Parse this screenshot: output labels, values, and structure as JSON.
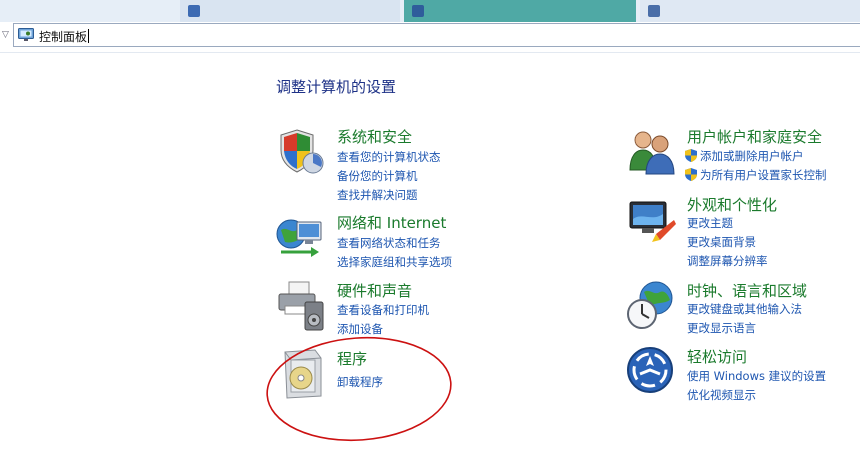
{
  "address_bar": {
    "path": "控制面板"
  },
  "main": {
    "title": "调整计算机的设置",
    "left": [
      {
        "title": "系统和安全",
        "links": [
          "查看您的计算机状态",
          "备份您的计算机",
          "查找并解决问题"
        ],
        "icon": "shield-icon"
      },
      {
        "title": "网络和 Internet",
        "links": [
          "查看网络状态和任务",
          "选择家庭组和共享选项"
        ],
        "icon": "network-globe-icon"
      },
      {
        "title": "硬件和声音",
        "links": [
          "查看设备和打印机",
          "添加设备"
        ],
        "icon": "printer-icon"
      },
      {
        "title": "程序",
        "links": [
          "卸载程序"
        ],
        "icon": "programs-disc-icon"
      }
    ],
    "right": [
      {
        "title": "用户帐户和家庭安全",
        "links": [
          "添加或删除用户帐户",
          "为所有用户设置家长控制"
        ],
        "icon": "users-icon"
      },
      {
        "title": "外观和个性化",
        "links": [
          "更改主题",
          "更改桌面背景",
          "调整屏幕分辨率"
        ],
        "icon": "monitor-palette-icon"
      },
      {
        "title": "时钟、语言和区域",
        "links": [
          "更改键盘或其他输入法",
          "更改显示语言"
        ],
        "icon": "clock-globe-icon"
      },
      {
        "title": "轻松访问",
        "links": [
          "使用 Windows 建议的设置",
          "优化视频显示"
        ],
        "icon": "ease-of-access-icon"
      }
    ]
  },
  "colors": {
    "category_title": "#1a7a2c",
    "link": "#1e56b0",
    "heading": "#1e3287",
    "annotation": "#cc1111"
  }
}
